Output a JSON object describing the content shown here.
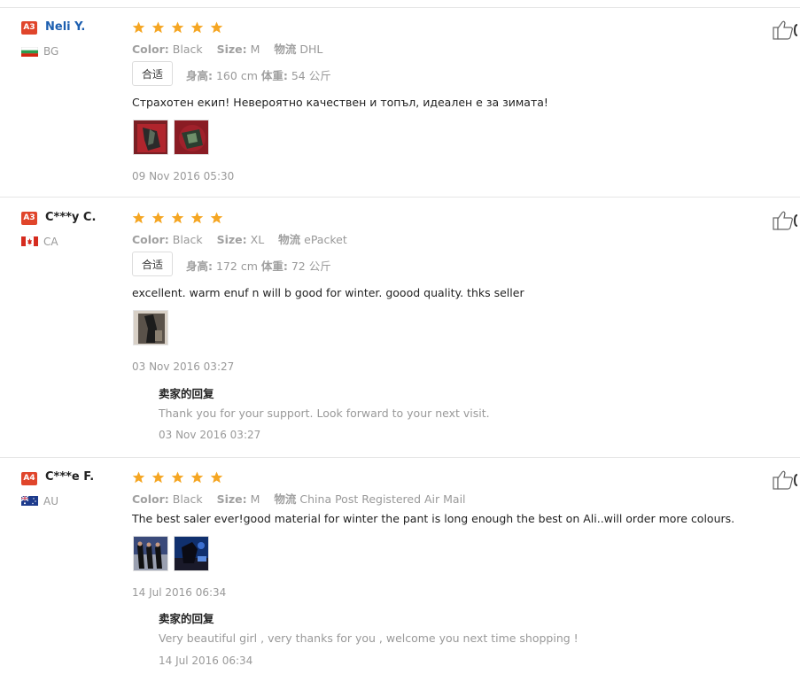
{
  "colors": {
    "star": "#f5a623",
    "badge": "#e0452b",
    "link": "#1d5fb0",
    "muted": "#999999"
  },
  "labels": {
    "color": "Color:",
    "size": "Size:",
    "shipping": "物流",
    "fit": "合适",
    "height": "身高:",
    "weight": "体重:",
    "reply_title": "卖家的回复"
  },
  "reviews": [
    {
      "badge": "A3",
      "name": "Neli Y.",
      "country": "BG",
      "flag_icon": "flag-bulgaria",
      "rating": 5,
      "color": "Black",
      "size": "M",
      "shipping": "DHL",
      "height": "160 cm",
      "weight": "54 公斤",
      "text": "Страхотен екип! Невероятно качествен и топъл, идеален е за зимата!",
      "photos": 2,
      "date": "09 Nov 2016 05:30"
    },
    {
      "badge": "A3",
      "name": "C***y C.",
      "country": "CA",
      "flag_icon": "flag-canada",
      "rating": 5,
      "color": "Black",
      "size": "XL",
      "shipping": "ePacket",
      "height": "172 cm",
      "weight": "72 公斤",
      "text": "excellent. warm enuf n will b good for winter. goood quality. thks seller",
      "photos": 1,
      "date": "03 Nov 2016 03:27",
      "reply": {
        "text": "Thank you for your support. Look forward to your next visit.",
        "date": "03 Nov 2016 03:27"
      }
    },
    {
      "badge": "A4",
      "name": "C***e F.",
      "country": "AU",
      "flag_icon": "flag-australia",
      "rating": 5,
      "color": "Black",
      "size": "M",
      "shipping": "China Post Registered Air Mail",
      "text": "The best saler ever!good material for winter the pant is long enough the best on Ali..will order more colours.",
      "photos": 2,
      "date": "14 Jul 2016 06:34",
      "reply": {
        "text": "Very beautiful girl , very thanks for you , welcome you next time shopping !",
        "date": "14 Jul 2016 06:34"
      }
    }
  ]
}
